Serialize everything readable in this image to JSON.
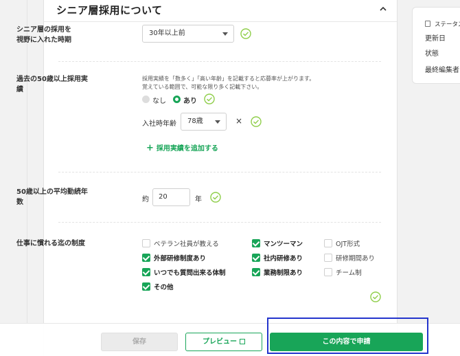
{
  "section": {
    "title": "シニア層採用について"
  },
  "hire_timing": {
    "label_line1": "シニア層の採用を",
    "label_line2": "視野に入れた時期",
    "selected": "30年以上前"
  },
  "past_hires": {
    "label_line1": "過去の50歳以上採用実",
    "label_line2": "績",
    "note_line1": "採用実績を「数多く」「高い年齢」を記載すると応募率が上がります。",
    "note_line2": "覚えている範囲で、可能な限り多く記載下さい。",
    "option_none": "なし",
    "option_yes": "あり",
    "age_label": "入社時年齢",
    "age_selected": "78歳",
    "remove_symbol": "×",
    "add_link": "採用実績を追加する",
    "add_plus": "+"
  },
  "tenure": {
    "label_line1": "50歳以上の平均勤続年",
    "label_line2": "数",
    "prefix": "約",
    "value": "20",
    "suffix": "年"
  },
  "support": {
    "label": "仕事に慣れる迄の制度",
    "options": [
      {
        "label": "ベテラン社員が教える",
        "checked": false
      },
      {
        "label": "マンツーマン",
        "checked": true
      },
      {
        "label": "OJT形式",
        "checked": false
      },
      {
        "label": "外部研修制度あり",
        "checked": true
      },
      {
        "label": "社内研修あり",
        "checked": true
      },
      {
        "label": "研修期間あり",
        "checked": false
      },
      {
        "label": "いつでも質問出来る体制",
        "checked": true
      },
      {
        "label": "業務制限あり",
        "checked": true
      },
      {
        "label": "チーム制",
        "checked": false
      },
      {
        "label": "その他",
        "checked": true
      }
    ]
  },
  "status": {
    "title": "ステータス",
    "rows": [
      "更新日",
      "状態",
      "最終編集者"
    ]
  },
  "footer": {
    "save": "保存",
    "preview": "プレビュー",
    "apply": "この内容で申請"
  },
  "colors": {
    "accent": "#18a558",
    "highlight": "#2233cc"
  }
}
